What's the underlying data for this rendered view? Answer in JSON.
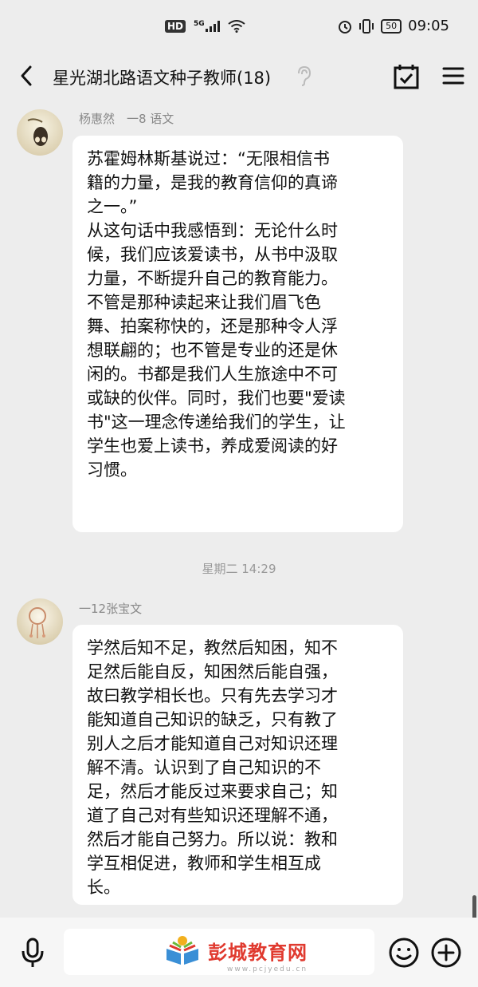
{
  "status_bar": {
    "network_badge": "HD",
    "signal_label": "5G",
    "battery": "50",
    "time": "09:05",
    "icons": [
      "alarm-icon",
      "vibrate-icon",
      "battery-icon",
      "signal-icon",
      "wifi-icon"
    ]
  },
  "header": {
    "title": "星光湖北路语文种子教师(18)",
    "icons": [
      "back-icon",
      "ear-icon",
      "calendar-check-icon",
      "menu-icon"
    ]
  },
  "messages": [
    {
      "sender": "杨惠然　一8  语文",
      "text": "苏霍姆林斯基说过：“无限相信书\n籍的力量，是我的教育信仰的真谛\n之一。”\n从这句话中我感悟到：无论什么时\n候，我们应该爱读书，从书中汲取\n力量，不断提升自己的教育能力。\n不管是那种读起来让我们眉飞色\n舞、拍案称快的，还是那种令人浮\n想联翩的；也不管是专业的还是休\n闲的。书都是我们人生旅途中不可\n或缺的伙伴。同时，我们也要\"爱读\n书\"这一理念传递给我们的学生，让\n学生也爱上读书，养成爱阅读的好\n习惯。"
    },
    {
      "sender": "一12张宝文",
      "text": "学然后知不足，教然后知困，知不\n足然后能自反，知困然后能自强，\n故曰教学相长也。只有先去学习才\n能知道自己知识的缺乏，只有教了\n别人之后才能知道自己对知识还理\n解不清。认识到了自己知识的不\n足，然后才能反过来要求自己；知\n道了自己对有些知识还理解不通，\n然后才能自己努力。所以说：教和\n学互相促进，教师和学生相互成\n长。"
    }
  ],
  "timestamp": "星期二 14:29",
  "bottom_bar": {
    "watermark_logo": "彭城教育网",
    "watermark_sub": "www.pcjyedu.cn",
    "icons": [
      "microphone-icon",
      "emoji-icon",
      "plus-icon"
    ]
  },
  "colors": {
    "background": "#ededed",
    "bubble": "#ffffff",
    "watermark_red": "#e03a2f"
  }
}
